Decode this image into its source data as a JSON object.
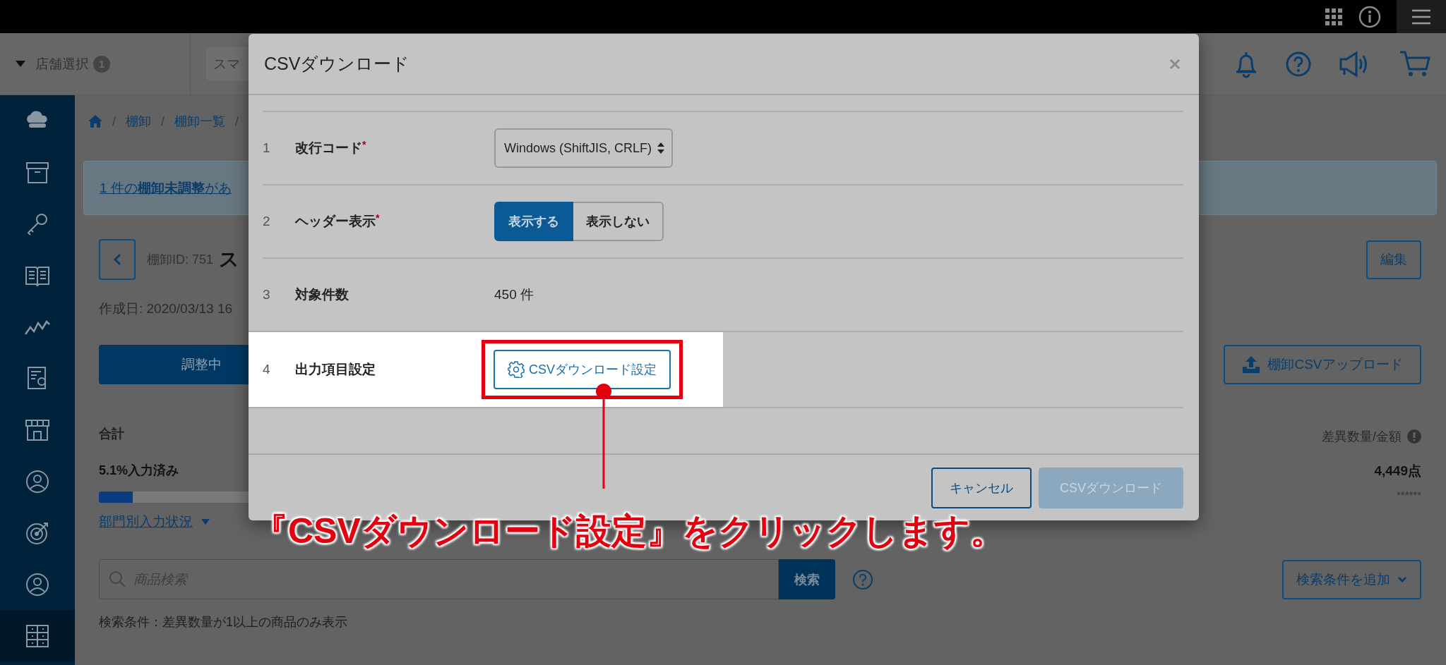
{
  "header": {
    "store_select": {
      "label": "店舗選択",
      "badge": "1"
    },
    "search": {
      "placeholder": "スマ"
    }
  },
  "sidebar": {
    "items": [
      {
        "selected": false
      },
      {
        "selected": false
      },
      {
        "selected": false
      },
      {
        "selected": false
      },
      {
        "selected": false
      },
      {
        "selected": false
      },
      {
        "selected": false
      },
      {
        "selected": false
      },
      {
        "selected": false
      },
      {
        "selected": false
      },
      {
        "selected": true
      }
    ]
  },
  "breadcrumb": {
    "separators": [
      "/",
      "/",
      "/"
    ],
    "items": [
      "棚卸",
      "棚卸一覧"
    ]
  },
  "alert": {
    "text": "1 件の**棚卸未調整**があ"
  },
  "inventory": {
    "id_label": "棚卸ID: 751",
    "name": "ス",
    "created": "作成日: 2020/03/13 16",
    "status_button": "調整中",
    "edit_button": "編集",
    "upload_button": "棚卸CSVアップロード"
  },
  "summary": {
    "total_label": "合計",
    "progress_text": "5.1%入力済み",
    "level": 0.051,
    "breakdown_link": "部門別入力状況",
    "diff_label": "差異数量/金額",
    "diff_value": "4,449点",
    "diff_amount": "******"
  },
  "search": {
    "placeholder": "商品検索",
    "button": "検索",
    "add_condition": "検索条件を追加",
    "condition_text": "検索条件：差異数量が1以上の商品のみ表示"
  },
  "modal": {
    "title": "CSVダウンロード",
    "rows": [
      {
        "number": "1",
        "label": "改行コード",
        "required_mark": "*",
        "kind": "select",
        "value": "Windows (ShiftJIS, CRLF)"
      },
      {
        "number": "2",
        "label": "ヘッダー表示",
        "required_mark": "*",
        "kind": "toggle",
        "options": [
          {
            "label": "表示する",
            "selected": true
          },
          {
            "label": "表示しない",
            "selected": false
          }
        ]
      },
      {
        "number": "3",
        "label": "対象件数",
        "kind": "text",
        "value": "450 件"
      },
      {
        "number": "4",
        "label": "出力項目設定",
        "kind": "button",
        "button": "CSVダウンロード設定",
        "highlighted": true
      }
    ],
    "buttons": [
      {
        "label": "キャンセル",
        "kind": "secondary"
      },
      {
        "label": "CSVダウンロード",
        "kind": "primary",
        "disabled": true
      }
    ]
  },
  "annotation": {
    "text": "『CSVダウンロード設定』をクリックします。"
  }
}
